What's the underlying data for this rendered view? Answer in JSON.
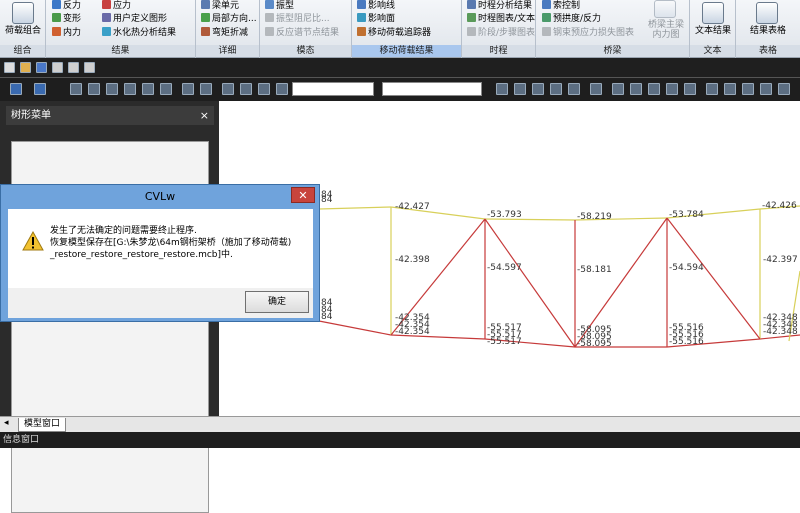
{
  "ribbon": {
    "groups": [
      {
        "label": "组合"
      },
      {
        "label": "结果"
      },
      {
        "label": "详细"
      },
      {
        "label": "模态"
      },
      {
        "label": "移动荷载结果"
      },
      {
        "label": "时程"
      },
      {
        "label": "桥梁"
      },
      {
        "label": "文本"
      },
      {
        "label": "表格"
      }
    ],
    "combo_button": "荷载组合",
    "result_items": [
      "反力",
      "变形",
      "内力",
      "应力",
      "用户定义图形",
      "水化热分析结果"
    ],
    "detail_items": [
      "梁单元",
      "局部方向...",
      "弯矩折减"
    ],
    "modal_items": [
      "振型",
      "振型阻尼比...",
      "反应谱节点结果"
    ],
    "moving_items": [
      "影响线",
      "影响面",
      "移动荷载追踪器"
    ],
    "history_items": [
      "时程分析结果",
      "时程图表/文本",
      "阶段/步骤图表"
    ],
    "bridge_items": [
      "索控制",
      "预拱度/反力",
      "钢束预应力损失图表"
    ],
    "bridge_big": [
      "桥梁主梁",
      "内力图"
    ],
    "text_button": "文本结果",
    "table_button": "结果表格"
  },
  "panel": {
    "title": "树形菜单",
    "close": "×"
  },
  "dialog": {
    "title": "CVLw",
    "close": "✕",
    "message_line1": "发生了无法确定的问题需要终止程序.",
    "message_line2": "恢复模型保存在[G:\\朱梦龙\\64m钢桁架桥（施加了移动荷载)",
    "message_line3": "_restore_restore_restore_restore.mcb]中.",
    "ok": "确定"
  },
  "bottom_tab": "模型窗口",
  "status": "信息窗口",
  "chart_data": {
    "type": "diagram",
    "labels": [
      "-42.427",
      "-53.793",
      "-58.219",
      "-53.784",
      "-42.426",
      "-42.398",
      "-54.597",
      "-58.181",
      "-54.594",
      "-42.397",
      "-42.354",
      "-42.354",
      "-42.354",
      "-55.517",
      "-55.517",
      "-55.517",
      "-58.095",
      "-58.095",
      "-58.095",
      "-55.516",
      "-55.516",
      "-55.516",
      "-42.348",
      "-42.348",
      "-42.348",
      "84",
      "84",
      "84",
      "84",
      "84"
    ],
    "colors": {
      "top": "#d8d05a",
      "web": "#c63a3a",
      "bottom": "#c63a3a",
      "label": "#333333"
    }
  }
}
